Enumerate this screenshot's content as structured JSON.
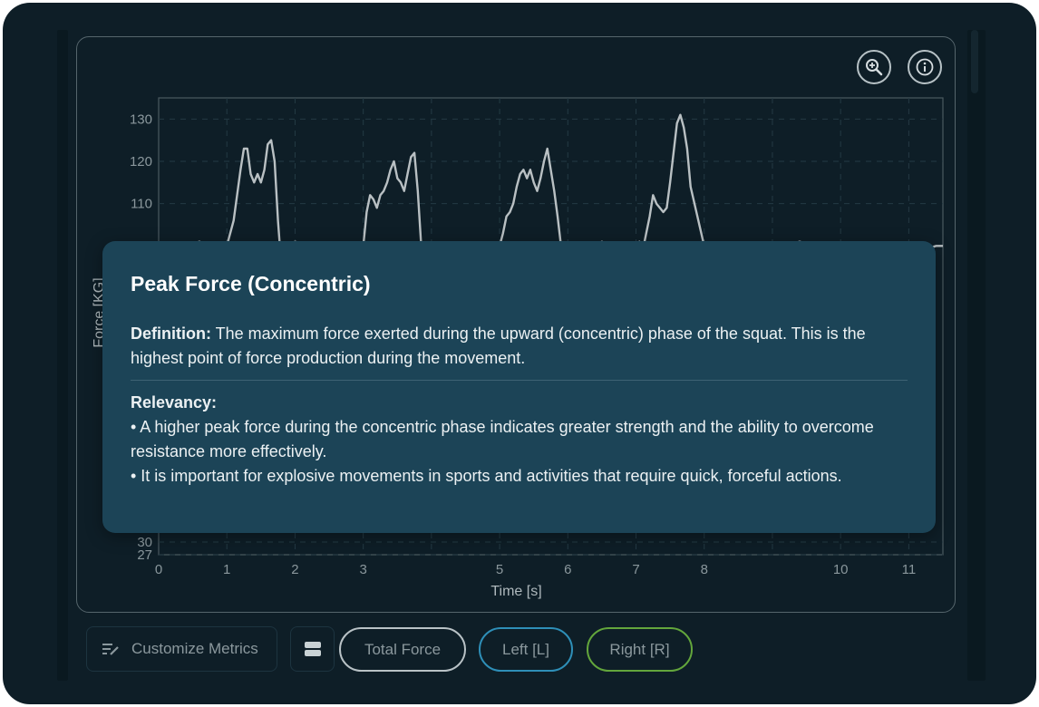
{
  "chart_controls": {
    "zoom_icon": "zoom-in-icon",
    "info_icon": "info-icon"
  },
  "chart_data": {
    "type": "line",
    "xlabel": "Time [s]",
    "ylabel": "Force [KG]",
    "xlim": [
      0,
      11.5
    ],
    "ylim": [
      27,
      135
    ],
    "x_ticks": [
      "0",
      "1",
      "2",
      "3",
      "5",
      "6",
      "7",
      "8",
      "10",
      "11"
    ],
    "y_ticks": [
      "27",
      "30",
      "110",
      "120",
      "130"
    ],
    "grid": true,
    "line_color": "#b9c0c3",
    "series": [
      {
        "x": [
          0,
          0.2,
          0.4,
          0.6,
          0.7,
          0.8,
          1,
          1.1,
          1.2,
          1.25,
          1.3,
          1.35,
          1.4,
          1.45,
          1.5,
          1.55,
          1.6,
          1.65,
          1.7,
          1.75,
          1.8,
          1.9,
          2,
          2.2,
          2.4,
          2.6,
          2.8,
          2.9,
          3,
          3.05,
          3.1,
          3.15,
          3.2,
          3.25,
          3.3,
          3.35,
          3.4,
          3.45,
          3.5,
          3.55,
          3.6,
          3.65,
          3.7,
          3.75,
          3.8,
          3.85,
          3.9,
          3.95,
          4,
          4.2,
          4.4,
          4.6,
          4.8,
          4.9,
          5,
          5.05,
          5.1,
          5.15,
          5.2,
          5.25,
          5.3,
          5.35,
          5.4,
          5.45,
          5.5,
          5.55,
          5.6,
          5.65,
          5.7,
          5.75,
          5.8,
          5.85,
          5.9,
          5.95,
          6,
          6.1,
          6.2,
          6.3,
          6.4,
          6.5,
          6.6,
          6.7,
          6.8,
          6.9,
          7,
          7.05,
          7.1,
          7.15,
          7.2,
          7.25,
          7.3,
          7.35,
          7.4,
          7.45,
          7.5,
          7.55,
          7.6,
          7.65,
          7.7,
          7.75,
          7.8,
          8,
          8.2,
          8.4,
          8.6,
          8.8,
          9,
          9.2,
          9.4,
          9.6,
          9.8,
          10,
          10.2,
          10.4,
          10.6,
          10.8,
          11,
          11.2,
          11.4,
          11.5
        ],
        "y": [
          100,
          100,
          100,
          101,
          100,
          98,
          100,
          106,
          118,
          123,
          123,
          117,
          115,
          117,
          115,
          118,
          124,
          125,
          120,
          106,
          95,
          100,
          101,
          100,
          100,
          99,
          100,
          98,
          100,
          108,
          112,
          111,
          109,
          112,
          113,
          115,
          118,
          120,
          116,
          115,
          113,
          117,
          121,
          122,
          113,
          100,
          94,
          100,
          100,
          100,
          100,
          99,
          100,
          98,
          100,
          103,
          107,
          108,
          110,
          114,
          117,
          118,
          116,
          118,
          115,
          113,
          116,
          120,
          123,
          118,
          113,
          107,
          100,
          93,
          100,
          100,
          99,
          100,
          100,
          101,
          100,
          98,
          100,
          99,
          100,
          101,
          99,
          103,
          107,
          112,
          110,
          109,
          108,
          109,
          115,
          122,
          129,
          131,
          128,
          123,
          114,
          100,
          100,
          100,
          100,
          99,
          100,
          100,
          101,
          100,
          100,
          100,
          99,
          100,
          100,
          100,
          100,
          99,
          100,
          100
        ]
      }
    ]
  },
  "tooltip": {
    "title": "Peak Force (Concentric)",
    "definition_label": "Definition:",
    "definition_text": " The maximum force exerted during the upward (concentric) phase of the squat. This is the highest point of force production during the movement.",
    "relevancy_label": "Relevancy:",
    "bullet_1": "• A higher peak force during the concentric phase indicates greater strength and the ability to overcome resistance more effectively.",
    "bullet_2": "• It is important for explosive movements in sports and activities that require quick, forceful actions."
  },
  "bottom_bar": {
    "customize_label": "Customize Metrics",
    "customize_icon": "edit-list-icon",
    "layout_icon": "stacked-layout-icon",
    "total_label": "Total Force",
    "left_label": "Left [L]",
    "right_label": "Right [R]",
    "total_color": "#b9c2c6",
    "left_color": "#2e8fb8",
    "right_color": "#63a63c"
  }
}
